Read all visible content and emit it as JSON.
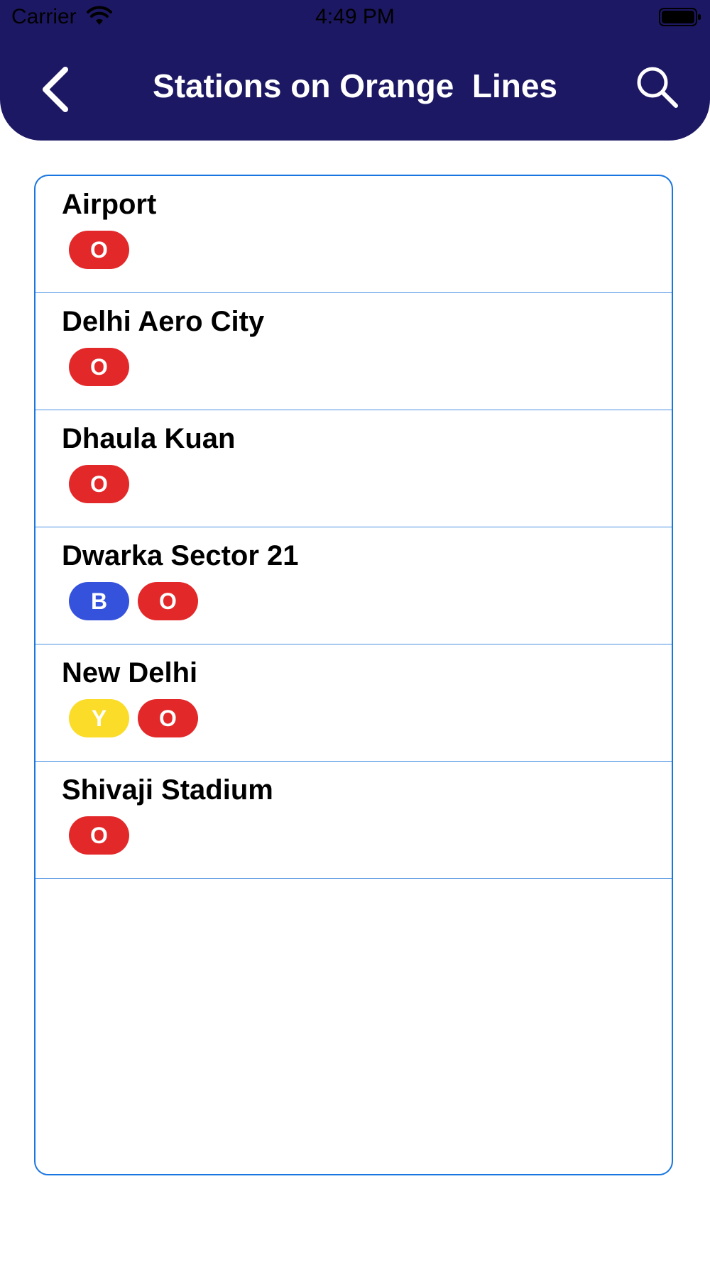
{
  "status_bar": {
    "carrier": "Carrier",
    "time": "4:49 PM"
  },
  "nav": {
    "title": "Stations on Orange  Lines",
    "back_icon": "chevron-left-icon",
    "search_icon": "search-icon"
  },
  "colors": {
    "header": "#1d1863",
    "border": "#1976e0",
    "O": "#e3282a",
    "B": "#3552dc",
    "Y": "#fbdc28"
  },
  "stations": [
    {
      "name": "Airport",
      "lines": [
        "O"
      ]
    },
    {
      "name": "Delhi Aero City",
      "lines": [
        "O"
      ]
    },
    {
      "name": "Dhaula Kuan",
      "lines": [
        "O"
      ]
    },
    {
      "name": "Dwarka Sector 21",
      "lines": [
        "B",
        "O"
      ]
    },
    {
      "name": "New Delhi",
      "lines": [
        "Y",
        "O"
      ]
    },
    {
      "name": "Shivaji Stadium",
      "lines": [
        "O"
      ]
    }
  ]
}
